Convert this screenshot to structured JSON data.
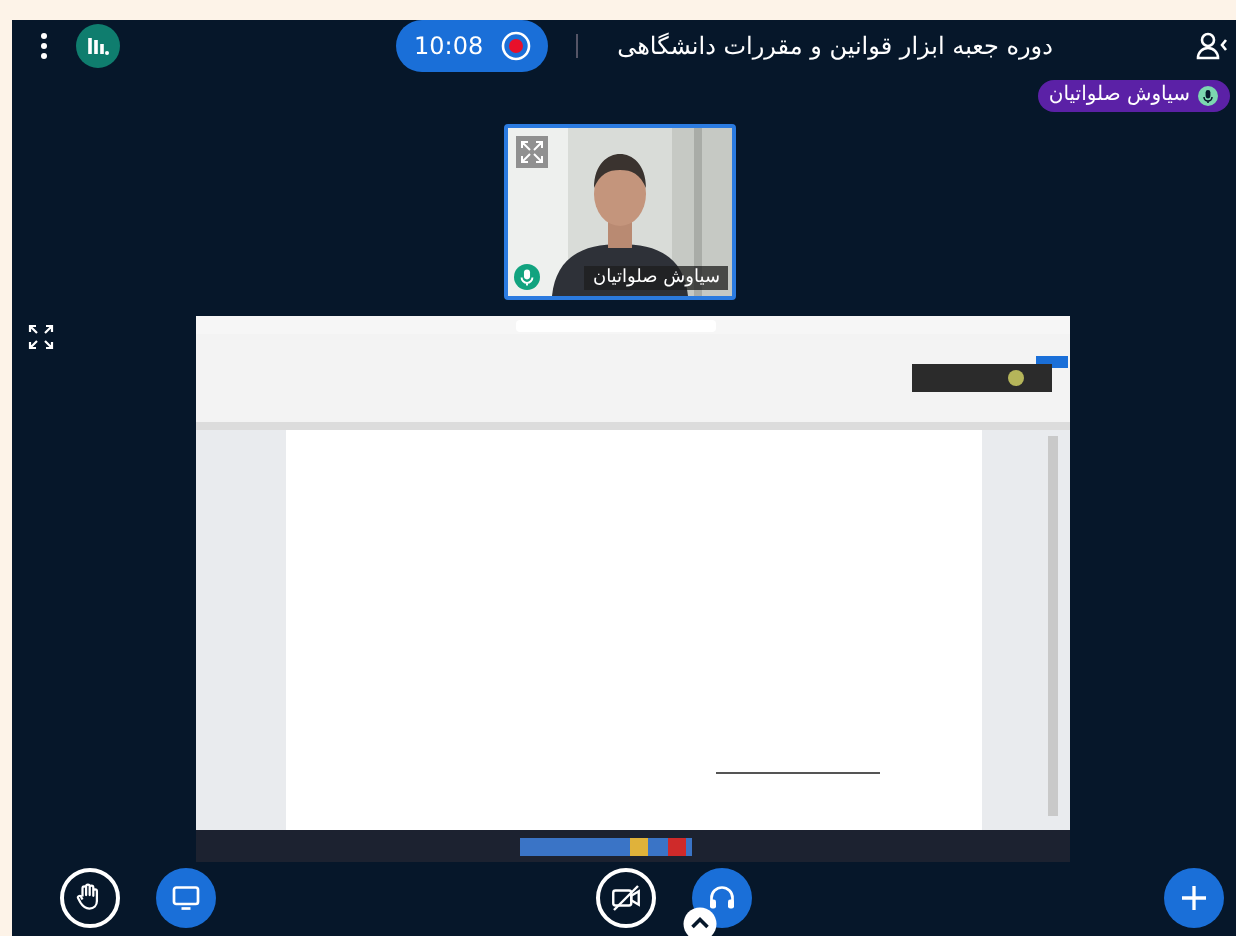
{
  "header": {
    "title": "دوره جعبه ابزار قوانین و مقررات دانشگاهی",
    "timer": "10:08",
    "recording": true
  },
  "presenter_badge": {
    "name": "سیاوش صلواتیان"
  },
  "video_tile": {
    "name": "سیاوش صلواتیان",
    "kind": "picture"
  },
  "action_bar": [
    {
      "kind": "hand",
      "on": false
    },
    {
      "kind": "screen",
      "on": true
    },
    {
      "kind": "camera",
      "on": false
    },
    {
      "kind": "audio",
      "on": true
    },
    {
      "kind": "plus",
      "on": true
    }
  ]
}
